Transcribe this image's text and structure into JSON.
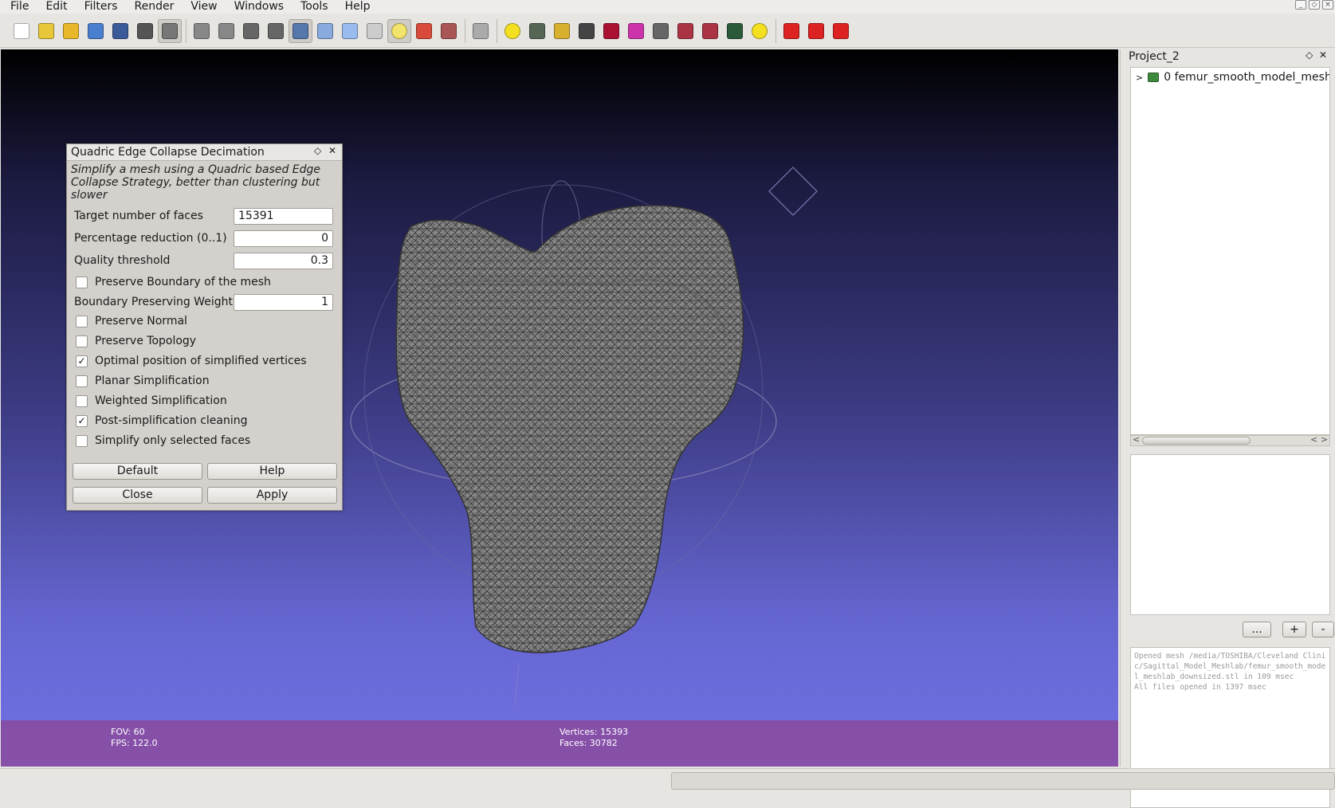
{
  "menu": [
    "File",
    "Edit",
    "Filters",
    "Render",
    "View",
    "Windows",
    "Tools",
    "Help"
  ],
  "toolbar_icons": [
    {
      "name": "new-file-icon",
      "color": "#ffffff"
    },
    {
      "name": "open-project-icon",
      "color": "#e8c83a"
    },
    {
      "name": "import-mesh-icon",
      "color": "#e8b82a"
    },
    {
      "name": "reload-icon",
      "color": "#4a7fd0"
    },
    {
      "name": "save-project-icon",
      "color": "#3a5a9a"
    },
    {
      "name": "snapshot-icon",
      "color": "#555555"
    },
    {
      "name": "layers-icon",
      "color": "#777777"
    },
    {
      "name": "bounding-box-icon",
      "color": "#888888"
    },
    {
      "name": "points-icon",
      "color": "#888888"
    },
    {
      "name": "wireframe-icon",
      "color": "#666666"
    },
    {
      "name": "hidden-lines-icon",
      "color": "#666666"
    },
    {
      "name": "flat-lines-icon",
      "color": "#5577aa"
    },
    {
      "name": "flat-icon",
      "color": "#88aadd"
    },
    {
      "name": "smooth-icon",
      "color": "#99bbee"
    },
    {
      "name": "texture-icon",
      "color": "#cccccc"
    },
    {
      "name": "light-icon",
      "color": "#f2e36a"
    },
    {
      "name": "double-side-lighting-icon",
      "color": "#d94a3a"
    },
    {
      "name": "back-face-culling-icon",
      "color": "#aa5555"
    },
    {
      "name": "select-tool-icon",
      "color": "#aaaaaa"
    },
    {
      "name": "annotation-icon",
      "color": "#f5e020"
    },
    {
      "name": "manipulator-icon",
      "color": "#556655"
    },
    {
      "name": "paint-icon",
      "color": "#d8b030"
    },
    {
      "name": "brush-icon",
      "color": "#444444"
    },
    {
      "name": "pick-points-icon",
      "color": "#aa1133"
    },
    {
      "name": "color-paint-icon",
      "color": "#cc33aa"
    },
    {
      "name": "measure-icon",
      "color": "#666666"
    },
    {
      "name": "select-faces-icon",
      "color": "#aa3344"
    },
    {
      "name": "select-vertices-icon",
      "color": "#aa3344"
    },
    {
      "name": "raster-icon",
      "color": "#2a5a3a"
    },
    {
      "name": "info-icon",
      "color": "#f5e020"
    },
    {
      "name": "delete-faces-icon",
      "color": "#dd2222"
    },
    {
      "name": "delete-vertices-icon",
      "color": "#dd2222"
    },
    {
      "name": "delete-selection-icon",
      "color": "#dd2222"
    }
  ],
  "viewport": {
    "fov": "FOV: 60",
    "fps": "FPS:   122.0",
    "vertices": "Vertices: 15393",
    "faces": "Faces: 30782"
  },
  "dialog": {
    "title": "Quadric Edge Collapse Decimation",
    "description": "Simplify a mesh using a Quadric based Edge Collapse Strategy, better than clustering but slower",
    "params": [
      {
        "label": "Target number of faces",
        "value": "15391"
      },
      {
        "label": "Percentage reduction (0..1)",
        "value": "0"
      },
      {
        "label": "Quality threshold",
        "value": "0.3"
      }
    ],
    "preserve_boundary": "Preserve Boundary of the mesh",
    "boundary_weight": {
      "label": "Boundary Preserving Weight",
      "value": "1"
    },
    "checkboxes": [
      {
        "label": "Preserve Normal",
        "checked": false
      },
      {
        "label": "Preserve Topology",
        "checked": false
      },
      {
        "label": "Optimal position of simplified vertices",
        "checked": true
      },
      {
        "label": "Planar Simplification",
        "checked": false
      },
      {
        "label": "Weighted Simplification",
        "checked": false
      },
      {
        "label": "Post-simplification cleaning",
        "checked": true
      },
      {
        "label": "Simplify only selected faces",
        "checked": false
      }
    ],
    "buttons": {
      "default": "Default",
      "help": "Help",
      "close": "Close",
      "apply": "Apply"
    }
  },
  "project": {
    "title": "Project_2",
    "layer": "0  femur_smooth_model_mesh",
    "buttons": {
      "more": "...",
      "add": "+",
      "remove": "-"
    },
    "log": "Opened mesh /media/TOSHIBA/Cleveland Clinic/Sagittal_Model_Meshlab/femur_smooth_model_meshlab_downsized.stl in 109 msec\nAll files opened in 1397 msec"
  }
}
